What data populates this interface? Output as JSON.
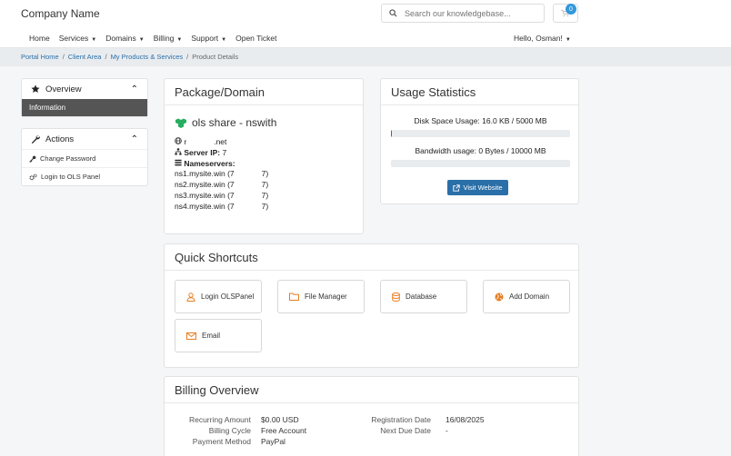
{
  "header": {
    "brand": "Company Name",
    "search_placeholder": "Search our knowledgebase...",
    "cart_count": "0",
    "nav": [
      {
        "label": "Home",
        "dropdown": false
      },
      {
        "label": "Services",
        "dropdown": true
      },
      {
        "label": "Domains",
        "dropdown": true
      },
      {
        "label": "Billing",
        "dropdown": true
      },
      {
        "label": "Support",
        "dropdown": true
      },
      {
        "label": "Open Ticket",
        "dropdown": false
      }
    ],
    "user_greeting": "Hello, Osman!"
  },
  "breadcrumb": [
    "Portal Home",
    "Client Area",
    "My Products & Services",
    "Product Details"
  ],
  "sidebar": {
    "overview_title": "Overview",
    "overview_active": "Information",
    "actions_title": "Actions",
    "actions": [
      "Change Password",
      "Login to OLS Panel"
    ]
  },
  "package": {
    "heading": "Package/Domain",
    "product": "ols share - nswith",
    "domain_start": "r",
    "domain_end": ".net",
    "server_ip_label": "Server IP:",
    "server_ip_partial": "7",
    "nameservers_label": "Nameservers:",
    "nameservers": [
      {
        "host": "ns1.mysite.win (7",
        "end": "7)"
      },
      {
        "host": "ns2.mysite.win (7",
        "end": "7)"
      },
      {
        "host": "ns3.mysite.win (7",
        "end": "7)"
      },
      {
        "host": "ns4.mysite.win (7",
        "end": "7)"
      }
    ]
  },
  "usage": {
    "heading": "Usage Statistics",
    "disk_label": "Disk Space Usage: 16.0 KB / 5000 MB",
    "disk_percent": 0.3,
    "bandwidth_label": "Bandwidth usage: 0 Bytes / 10000 MB",
    "bandwidth_percent": 0,
    "visit_button": "Visit Website"
  },
  "shortcuts": {
    "heading": "Quick Shortcuts",
    "items": [
      {
        "label": "Login OLSPanel",
        "icon": "user-icon"
      },
      {
        "label": "File Manager",
        "icon": "folder-icon"
      },
      {
        "label": "Database",
        "icon": "database-icon"
      },
      {
        "label": "Add Domain",
        "icon": "globe-icon"
      },
      {
        "label": "Email",
        "icon": "envelope-icon"
      }
    ]
  },
  "billing": {
    "heading": "Billing Overview",
    "left": [
      {
        "label": "Recurring Amount",
        "value": "$0.00 USD"
      },
      {
        "label": "Billing Cycle",
        "value": "Free Account"
      },
      {
        "label": "Payment Method",
        "value": "PayPal"
      }
    ],
    "right": [
      {
        "label": "Registration Date",
        "value": "16/08/2025"
      },
      {
        "label": "Next Due Date",
        "value": "-"
      }
    ]
  },
  "colors": {
    "primary": "#2a6fa8",
    "accent_orange": "#e67e22",
    "icon_green": "#27ae60",
    "badge": "#3498db"
  }
}
